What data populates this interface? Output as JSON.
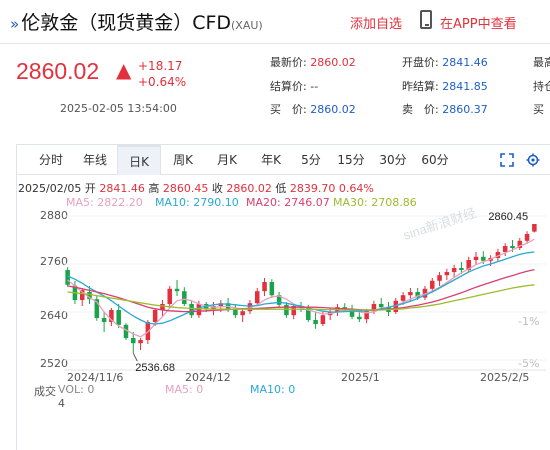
{
  "header": {
    "arrows": "»",
    "title": "伦敦金（现货黄金）CFD",
    "code": "(XAU)",
    "follow_label": "添加自选",
    "app_label": "在APP中查看"
  },
  "quote": {
    "price": "2860.02",
    "change": "+18.17",
    "change_pct": "+0.64%",
    "timestamp": "2025-02-05 13:54:00",
    "fields": [
      {
        "label": "最新价:",
        "value": "2860.02",
        "color": "red"
      },
      {
        "label": "开盘价:",
        "value": "2841.46",
        "color": "blue"
      },
      {
        "label": "最高",
        "value": "",
        "color": "gray"
      },
      {
        "label": "结算价:",
        "value": "--",
        "color": "gray"
      },
      {
        "label": "昨结算:",
        "value": "2841.85",
        "color": "blue"
      },
      {
        "label": "持仓",
        "value": "",
        "color": "gray"
      },
      {
        "label": "买　价:",
        "value": "2860.02",
        "color": "blue"
      },
      {
        "label": "卖　价:",
        "value": "2860.37",
        "color": "blue"
      },
      {
        "label": "买",
        "value": "",
        "color": "gray"
      }
    ]
  },
  "tabs": [
    "分时",
    "年线",
    "日K",
    "周K",
    "月K",
    "年K",
    "5分",
    "15分",
    "30分",
    "60分"
  ],
  "active_tab": "日K",
  "toolbar_icons": [
    "fullscreen-icon",
    "settings-icon"
  ],
  "ohlc": {
    "date": "2025/02/05",
    "open_label": "开",
    "open": "2841.46",
    "high_label": "高",
    "high": "2860.45",
    "close_label": "收",
    "close": "2860.02",
    "low_label": "低",
    "low": "2839.70",
    "pct": "0.64%"
  },
  "ma_legend": [
    {
      "label": "MA5: 2822.20",
      "color": "#e9a1bd"
    },
    {
      "label": "MA10: 2790.10",
      "color": "#2aa9d6"
    },
    {
      "label": "MA20: 2746.07",
      "color": "#d94070"
    },
    {
      "label": "MA30: 2708.86",
      "color": "#9bbc2e"
    }
  ],
  "volume_legend": {
    "label": "成交",
    "vol": "VOL: 0",
    "ma5": "MA5: 0",
    "ma10": "MA10: 0",
    "value": "4"
  },
  "watermark": "sina新浪财经",
  "chart_data": {
    "type": "candlestick",
    "y_ticks": [
      2880,
      2760,
      2640,
      2520
    ],
    "ylim": [
      2500,
      2900
    ],
    "right_axis_labels": [
      "-1%",
      "-5%"
    ],
    "x_labels": [
      "2024/11/6",
      "2024/12",
      "2025/1",
      "2025/2/5"
    ],
    "annotations": {
      "high": "2860.45",
      "low": "2536.68"
    },
    "candles": [
      [
        2745,
        2752,
        2703,
        2708
      ],
      [
        2706,
        2718,
        2660,
        2670
      ],
      [
        2670,
        2700,
        2655,
        2695
      ],
      [
        2690,
        2705,
        2660,
        2672
      ],
      [
        2672,
        2680,
        2618,
        2625
      ],
      [
        2625,
        2640,
        2590,
        2615
      ],
      [
        2615,
        2650,
        2605,
        2645
      ],
      [
        2645,
        2660,
        2600,
        2608
      ],
      [
        2608,
        2612,
        2570,
        2575
      ],
      [
        2575,
        2590,
        2537,
        2562
      ],
      [
        2562,
        2575,
        2545,
        2570
      ],
      [
        2570,
        2620,
        2560,
        2615
      ],
      [
        2615,
        2650,
        2605,
        2645
      ],
      [
        2645,
        2670,
        2630,
        2660
      ],
      [
        2660,
        2705,
        2650,
        2698
      ],
      [
        2698,
        2720,
        2680,
        2692
      ],
      [
        2692,
        2702,
        2655,
        2660
      ],
      [
        2660,
        2668,
        2625,
        2632
      ],
      [
        2632,
        2668,
        2625,
        2660
      ],
      [
        2660,
        2665,
        2640,
        2648
      ],
      [
        2648,
        2665,
        2632,
        2655
      ],
      [
        2655,
        2670,
        2640,
        2662
      ],
      [
        2662,
        2675,
        2640,
        2648
      ],
      [
        2648,
        2660,
        2625,
        2632
      ],
      [
        2632,
        2650,
        2615,
        2642
      ],
      [
        2642,
        2670,
        2635,
        2662
      ],
      [
        2662,
        2700,
        2655,
        2692
      ],
      [
        2692,
        2725,
        2680,
        2715
      ],
      [
        2715,
        2722,
        2675,
        2682
      ],
      [
        2682,
        2690,
        2650,
        2658
      ],
      [
        2658,
        2665,
        2625,
        2632
      ],
      [
        2632,
        2660,
        2622,
        2655
      ],
      [
        2655,
        2665,
        2640,
        2650
      ],
      [
        2650,
        2658,
        2615,
        2620
      ],
      [
        2620,
        2640,
        2598,
        2610
      ],
      [
        2610,
        2640,
        2605,
        2632
      ],
      [
        2632,
        2650,
        2620,
        2640
      ],
      [
        2640,
        2660,
        2630,
        2652
      ],
      [
        2652,
        2662,
        2640,
        2648
      ],
      [
        2648,
        2658,
        2622,
        2628
      ],
      [
        2628,
        2640,
        2615,
        2622
      ],
      [
        2622,
        2648,
        2612,
        2642
      ],
      [
        2642,
        2668,
        2635,
        2660
      ],
      [
        2660,
        2675,
        2648,
        2652
      ],
      [
        2652,
        2665,
        2630,
        2640
      ],
      [
        2640,
        2675,
        2635,
        2668
      ],
      [
        2668,
        2690,
        2658,
        2682
      ],
      [
        2682,
        2700,
        2665,
        2690
      ],
      [
        2690,
        2700,
        2670,
        2676
      ],
      [
        2676,
        2705,
        2670,
        2698
      ],
      [
        2698,
        2725,
        2690,
        2718
      ],
      [
        2718,
        2740,
        2705,
        2732
      ],
      [
        2732,
        2748,
        2720,
        2740
      ],
      [
        2740,
        2758,
        2725,
        2750
      ],
      [
        2750,
        2765,
        2735,
        2745
      ],
      [
        2745,
        2778,
        2740,
        2770
      ],
      [
        2770,
        2790,
        2758,
        2778
      ],
      [
        2778,
        2792,
        2760,
        2768
      ],
      [
        2768,
        2782,
        2755,
        2775
      ],
      [
        2775,
        2798,
        2765,
        2790
      ],
      [
        2790,
        2812,
        2780,
        2805
      ],
      [
        2805,
        2820,
        2790,
        2800
      ],
      [
        2800,
        2825,
        2795,
        2818
      ],
      [
        2818,
        2842,
        2810,
        2835
      ],
      [
        2841,
        2860,
        2839,
        2860
      ]
    ],
    "ma_series": [
      {
        "name": "MA5",
        "color": "#e9a1bd",
        "values": [
          2720,
          2705,
          2690,
          2676,
          2665,
          2640,
          2620,
          2605,
          2595,
          2585,
          2578,
          2590,
          2610,
          2628,
          2650,
          2668,
          2672,
          2668,
          2660,
          2655,
          2652,
          2653,
          2654,
          2650,
          2648,
          2650,
          2658,
          2670,
          2678,
          2680,
          2672,
          2660,
          2650,
          2645,
          2640,
          2635,
          2636,
          2640,
          2645,
          2645,
          2640,
          2638,
          2640,
          2648,
          2652,
          2656,
          2664,
          2672,
          2680,
          2685,
          2692,
          2702,
          2714,
          2726,
          2738,
          2748,
          2758,
          2766,
          2772,
          2780,
          2788,
          2795,
          2805,
          2812,
          2822
        ]
      },
      {
        "name": "MA10",
        "color": "#2aa9d6",
        "values": [
          2730,
          2722,
          2712,
          2700,
          2690,
          2680,
          2668,
          2655,
          2642,
          2630,
          2620,
          2612,
          2610,
          2612,
          2618,
          2626,
          2634,
          2642,
          2650,
          2655,
          2658,
          2660,
          2660,
          2658,
          2656,
          2655,
          2656,
          2660,
          2662,
          2664,
          2662,
          2658,
          2655,
          2650,
          2646,
          2642,
          2640,
          2640,
          2641,
          2642,
          2642,
          2643,
          2645,
          2648,
          2652,
          2656,
          2661,
          2667,
          2674,
          2682,
          2690,
          2700,
          2710,
          2720,
          2730,
          2740,
          2748,
          2755,
          2760,
          2766,
          2772,
          2778,
          2784,
          2788,
          2790
        ]
      },
      {
        "name": "MA20",
        "color": "#d94070",
        "values": [
          2705,
          2702,
          2698,
          2694,
          2690,
          2686,
          2681,
          2676,
          2670,
          2664,
          2658,
          2652,
          2648,
          2645,
          2643,
          2642,
          2641,
          2641,
          2642,
          2643,
          2644,
          2645,
          2646,
          2647,
          2648,
          2648,
          2649,
          2650,
          2651,
          2652,
          2652,
          2652,
          2652,
          2652,
          2652,
          2651,
          2650,
          2649,
          2648,
          2647,
          2646,
          2645,
          2645,
          2646,
          2647,
          2649,
          2651,
          2654,
          2657,
          2661,
          2665,
          2670,
          2676,
          2682,
          2688,
          2695,
          2702,
          2708,
          2714,
          2720,
          2726,
          2731,
          2737,
          2742,
          2746
        ]
      },
      {
        "name": "MA30",
        "color": "#9bbc2e",
        "values": [
          2690,
          2688,
          2686,
          2684,
          2681,
          2678,
          2675,
          2672,
          2669,
          2666,
          2663,
          2660,
          2657,
          2655,
          2653,
          2651,
          2650,
          2649,
          2648,
          2648,
          2647,
          2647,
          2647,
          2647,
          2647,
          2647,
          2647,
          2647,
          2647,
          2647,
          2647,
          2647,
          2647,
          2647,
          2647,
          2646,
          2646,
          2646,
          2645,
          2645,
          2645,
          2645,
          2645,
          2645,
          2646,
          2647,
          2648,
          2650,
          2652,
          2654,
          2657,
          2660,
          2664,
          2668,
          2672,
          2676,
          2680,
          2684,
          2688,
          2692,
          2696,
          2700,
          2703,
          2706,
          2708
        ]
      }
    ]
  }
}
